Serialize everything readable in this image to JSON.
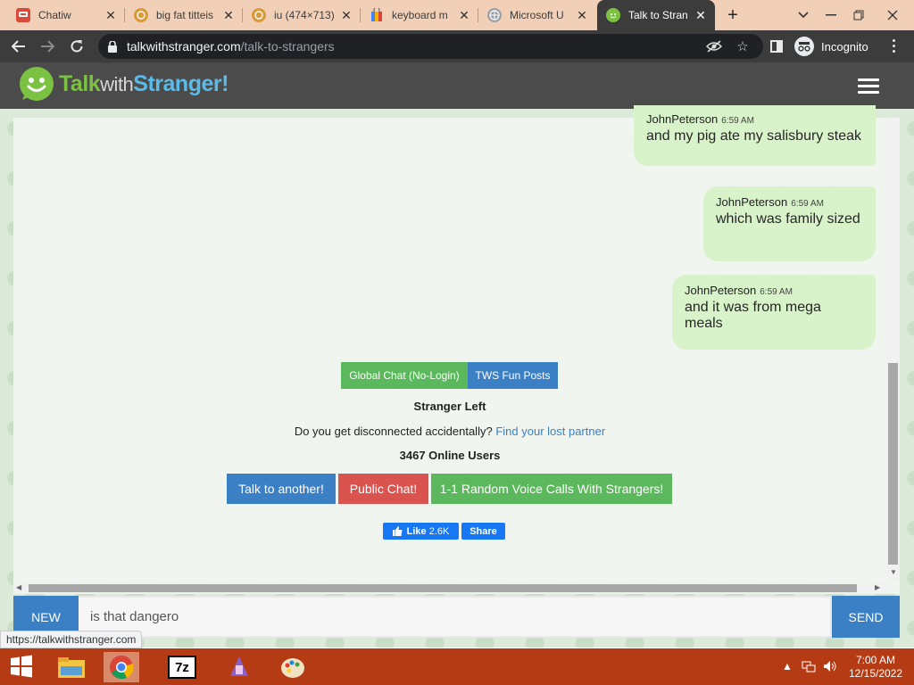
{
  "browser": {
    "tabs": [
      {
        "title": "Chatiw",
        "favicon_color": "#d94a3b",
        "favicon": "chat"
      },
      {
        "title": "big fat titteis",
        "favicon_color": "#d99a3b",
        "favicon": "globe"
      },
      {
        "title": "iu (474×713)",
        "favicon_color": "#d99a3b",
        "favicon": "globe"
      },
      {
        "title": "keyboard m",
        "favicon_color": "#4285f4",
        "favicon": "bag"
      },
      {
        "title": "Microsoft U",
        "favicon_color": "#9aa0a6",
        "favicon": "globe"
      },
      {
        "title": "Talk to Stran",
        "favicon_color": "#7cc242",
        "favicon": "smiley",
        "active": true
      }
    ],
    "new_tab": "+",
    "url_host": "talkwithstranger.com",
    "url_path": "/talk-to-strangers",
    "incognito_label": "Incognito"
  },
  "site": {
    "logo_talk": "Talk",
    "logo_with": "with",
    "logo_stranger": "Stranger!"
  },
  "messages": [
    {
      "author": "JohnPeterson",
      "time": "6:59 AM",
      "text": "and my pig ate my salisbury steak"
    },
    {
      "author": "JohnPeterson",
      "time": "6:59 AM",
      "text": "which was family sized"
    },
    {
      "author": "JohnPeterson",
      "time": "6:59 AM",
      "text": "and it was from mega meals"
    }
  ],
  "links": {
    "global_chat": "Global Chat (No-Login)",
    "fun_posts": "TWS Fun Posts"
  },
  "status": {
    "stranger_left": "Stranger Left",
    "disconnected_q": "Do you get disconnected accidentally?",
    "find_partner": "Find your lost partner",
    "online_users": "3467 Online Users"
  },
  "actions": {
    "talk_another": "Talk to another!",
    "public_chat": "Public Chat!",
    "voice_calls": "1-1 Random Voice Calls With Strangers!"
  },
  "social": {
    "like_label": "Like",
    "like_count": "2.6K",
    "share_label": "Share"
  },
  "composer": {
    "new_label": "NEW",
    "input_value": "is that dangero",
    "send_label": "SEND"
  },
  "status_bar_url": "https://talkwithstranger.com",
  "taskbar": {
    "time": "7:00 AM",
    "date": "12/15/2022"
  },
  "colors": {
    "green": "#5cb85c",
    "blue": "#3b7fc4",
    "red": "#d9534f",
    "bubble": "#d8f3c9",
    "taskbar": "#b53b14"
  }
}
